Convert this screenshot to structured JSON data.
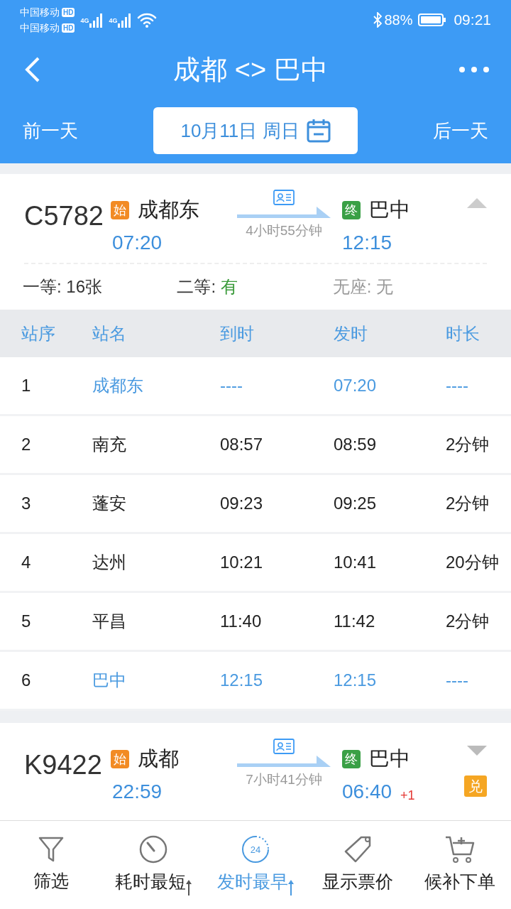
{
  "status_bar": {
    "carriers": [
      {
        "name": "中国移动",
        "hd": "HD"
      },
      {
        "name": "中国移动",
        "hd": "HD"
      }
    ],
    "signals": [
      {
        "network": "4G"
      },
      {
        "network": "4G"
      }
    ],
    "battery": "88%",
    "time": "09:21"
  },
  "header": {
    "title": "成都 <> 巴中",
    "prev_day": "前一天",
    "date": "10月11日 周日",
    "next_day": "后一天"
  },
  "trains": [
    {
      "number": "C5782",
      "from_tag": "始",
      "from": "成都东",
      "depart": "07:20",
      "duration": "4小时55分钟",
      "to_tag": "终",
      "to": "巴中",
      "arrive": "12:15",
      "expanded": true,
      "seats": [
        {
          "label": "一等:",
          "value": "16张",
          "kind": "count"
        },
        {
          "label": "二等:",
          "value": "有",
          "kind": "available"
        },
        {
          "label": "无座:",
          "value": "无",
          "kind": "none"
        }
      ],
      "stops": {
        "columns": [
          "站序",
          "站名",
          "到时",
          "发时",
          "时长"
        ],
        "rows": [
          {
            "cells": [
              "1",
              "成都东",
              "----",
              "07:20",
              "----"
            ],
            "highlight": true
          },
          {
            "cells": [
              "2",
              "南充",
              "08:57",
              "08:59",
              "2分钟"
            ],
            "highlight": false
          },
          {
            "cells": [
              "3",
              "蓬安",
              "09:23",
              "09:25",
              "2分钟"
            ],
            "highlight": false
          },
          {
            "cells": [
              "4",
              "达州",
              "10:21",
              "10:41",
              "20分钟"
            ],
            "highlight": false
          },
          {
            "cells": [
              "5",
              "平昌",
              "11:40",
              "11:42",
              "2分钟"
            ],
            "highlight": false
          },
          {
            "cells": [
              "6",
              "巴中",
              "12:15",
              "12:15",
              "----"
            ],
            "highlight": true
          }
        ]
      }
    },
    {
      "number": "K9422",
      "from_tag": "始",
      "from": "成都",
      "depart": "22:59",
      "duration": "7小时41分钟",
      "to_tag": "终",
      "to": "巴中",
      "arrive": "06:40",
      "day_offset": "+1",
      "badge": "兑",
      "expanded": false
    }
  ],
  "bottom_tabs": [
    {
      "label": "筛选",
      "kind": "filter",
      "selected": false
    },
    {
      "label": "耗时最短",
      "kind": "timer",
      "selected": false
    },
    {
      "label": "发时最早",
      "kind": "clock",
      "icon_text": "24",
      "selected": true
    },
    {
      "label": "显示票价",
      "kind": "tag",
      "selected": false
    },
    {
      "label": "候补下单",
      "kind": "cart",
      "selected": false
    }
  ]
}
